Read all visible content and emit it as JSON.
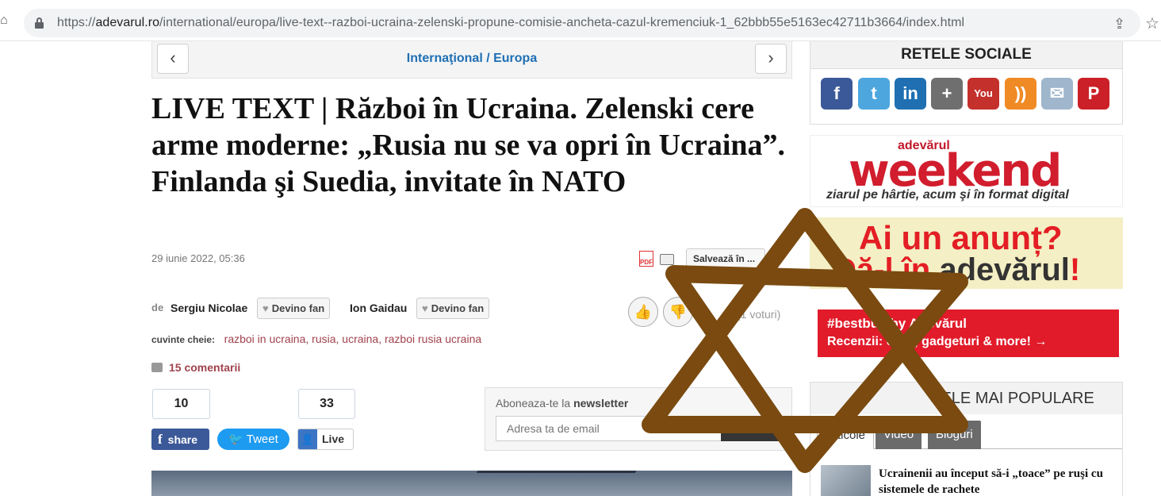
{
  "browser": {
    "url_scheme": "https://",
    "url_domain": "adevarul.ro",
    "url_path": "/international/europa/live-text--razboi-ucraina-zelenski-propune-comisie-ancheta-cazul-kremenciuk-1_62bbb55e5163ec42711b3664/index.html"
  },
  "nav": {
    "prev": "‹",
    "next": "›",
    "breadcrumb": "Internaţional / Europa"
  },
  "article": {
    "headline": "LIVE TEXT | Război în Ucraina. Zelenski cere arme moderne: „Rusia nu se va opri în Ucraina”. Finlanda şi Suedia, invitate în NATO",
    "date": "29 iunie 2022, 05:36",
    "save_label": "Salvează în ...",
    "pdf_label": "PDF",
    "by_label": "de",
    "authors": [
      {
        "name": "Sergiu Nicolae",
        "fan_label": "Devino fan"
      },
      {
        "name": "Ion Gaidau",
        "fan_label": "Devino fan"
      }
    ],
    "votes_text": "(1 voturi)",
    "tags_label": "cuvinte cheie:",
    "tags": "razboi in ucraina, rusia, ucraina, razboi rusia ucraina",
    "comments": "15 comentarii"
  },
  "share": {
    "fb_count": "10",
    "fb_label": "share",
    "fb_letter": "f",
    "tweet_label": "Tweet",
    "live_count": "33",
    "live_label": "Live"
  },
  "newsletter": {
    "title_prefix": "Aboneaza-te la",
    "title_bold": "newsletter",
    "placeholder": "Adresa ta de email",
    "button": "Aboneaza"
  },
  "sidebar": {
    "social_title": "RETELE SOCIALE",
    "social_icons": [
      {
        "name": "facebook",
        "glyph": "f",
        "color": "#3b5998"
      },
      {
        "name": "twitter",
        "glyph": "t",
        "color": "#4da7de"
      },
      {
        "name": "linkedin",
        "glyph": "in",
        "color": "#1f6fb2"
      },
      {
        "name": "google-plus",
        "glyph": "+",
        "color": "#6f6f6f"
      },
      {
        "name": "youtube",
        "glyph": "You",
        "color": "#c4302b"
      },
      {
        "name": "rss",
        "glyph": "))",
        "color": "#f08a24"
      },
      {
        "name": "email",
        "glyph": "✉",
        "color": "#9fb6cc"
      },
      {
        "name": "pinterest",
        "glyph": "P",
        "color": "#cb2027"
      }
    ],
    "weekend_brand": "adevărul",
    "weekend_word": "weekend",
    "weekend_tag": "ziarul pe hârtie, acum şi în format digital",
    "anunt_l1": "Ai un anunț?",
    "anunt_l2": "Dă-l în",
    "anunt_brand": "adevărul",
    "anunt_bang": "!",
    "bestbuy_t1": "#bestbuy by Adevărul",
    "bestbuy_t2": "Recenzii: case, gadgeturi & more! →",
    "popular_title": "CELE MAI POPULARE",
    "tabs": [
      "Articole",
      "Video",
      "Bloguri"
    ],
    "popular_item": "Ucrainenii au început să-i „toace” pe ruşi cu sistemele de rachete"
  },
  "colors": {
    "overlay_star": "#7a4a10",
    "link_blue": "#1e6fb5",
    "tag_red": "#a0424c"
  }
}
